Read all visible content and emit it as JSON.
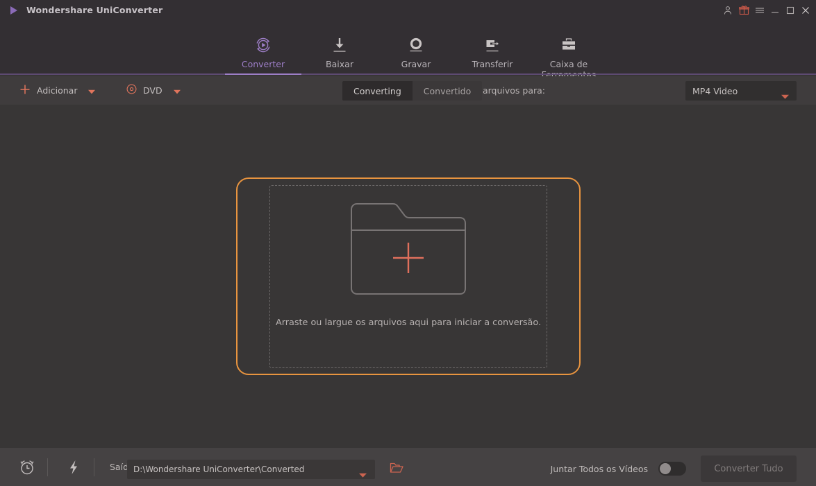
{
  "window": {
    "title": "Wondershare UniConverter",
    "logo_icon": "play-triangle-logo",
    "controls": [
      {
        "name": "account-icon",
        "glyph": "person"
      },
      {
        "name": "gift-icon",
        "glyph": "gift"
      },
      {
        "name": "menu-icon",
        "glyph": "hamburger"
      },
      {
        "name": "minimize-button",
        "glyph": "minimize"
      },
      {
        "name": "maximize-button",
        "glyph": "maximize"
      },
      {
        "name": "close-button",
        "glyph": "close"
      }
    ]
  },
  "nav": {
    "tabs": [
      {
        "label": "Converter",
        "icon": "convert-circular-arrow-icon",
        "active": true
      },
      {
        "label": "Baixar",
        "icon": "download-arrow-icon",
        "active": false
      },
      {
        "label": "Gravar",
        "icon": "burn-disc-icon",
        "active": false
      },
      {
        "label": "Transferir",
        "icon": "transfer-device-icon",
        "active": false
      },
      {
        "label": "Caixa de Ferramentas",
        "icon": "toolbox-briefcase-icon",
        "active": false
      }
    ]
  },
  "toolbar": {
    "add_label": "Adicionar",
    "add_icon": "plus-icon",
    "add_caret": "chevron-down-icon",
    "dvd_label": "DVD",
    "dvd_icon": "disc-icon",
    "dvd_caret": "chevron-down-icon",
    "segments": [
      {
        "label": "Converting",
        "active": true
      },
      {
        "label": "Convertido",
        "active": false
      }
    ],
    "convert_all_to_label": "Converter todos os arquivos para:",
    "format_value": "MP4 Video",
    "format_caret": "chevron-down-icon"
  },
  "main": {
    "folder_icon": "folder-plus-icon",
    "drop_text": "Arraste ou largue os arquivos aqui para iniciar a conversão."
  },
  "bottom": {
    "alarm_icon": "alarm-clock-icon",
    "speed_icon": "lightning-bolt-icon",
    "output_label": "Saída:",
    "output_path": "D:\\Wondershare UniConverter\\Converted",
    "output_caret": "chevron-down-icon",
    "open_folder_icon": "open-folder-icon",
    "merge_label": "Juntar Todos os Vídeos",
    "merge_on": false,
    "convert_all_button": "Converter Tudo"
  },
  "colors": {
    "accent_purple": "#9d7ec7",
    "accent_orange": "#e8943f",
    "accent_salmon": "#d9705c",
    "titlebar_bg": "#332f33",
    "toolbar_bg": "#3f3c3d",
    "main_bg": "#383636",
    "bottombar_bg": "#454243"
  }
}
